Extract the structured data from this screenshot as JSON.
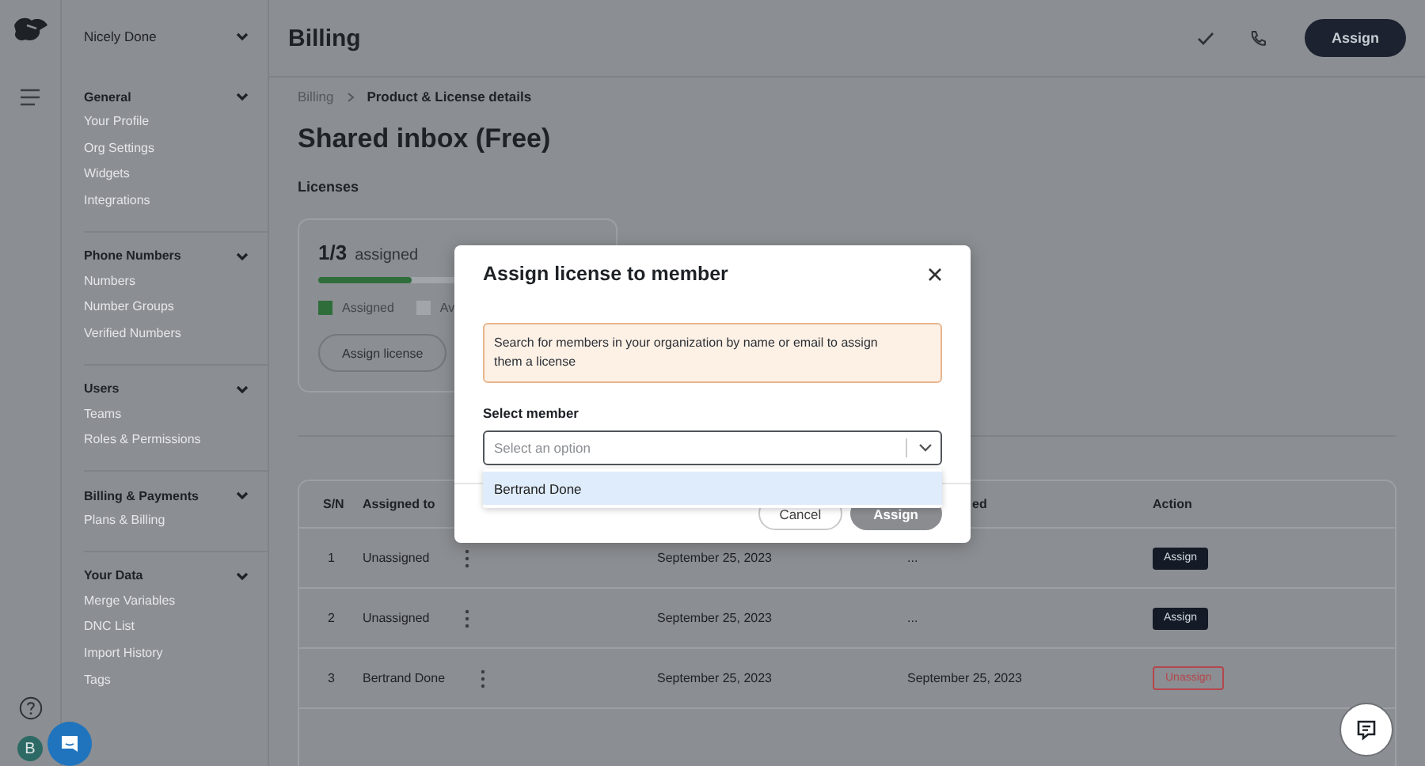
{
  "account": {
    "name": "Nicely Done",
    "avatar_initial": "B"
  },
  "sidebar": {
    "sections": [
      {
        "title": "General",
        "expanded": true,
        "items": [
          "Your Profile",
          "Org Settings",
          "Widgets",
          "Integrations"
        ]
      },
      {
        "title": "Phone Numbers",
        "expanded": true,
        "items": [
          "Numbers",
          "Number Groups",
          "Verified Numbers"
        ]
      },
      {
        "title": "Users",
        "expanded": true,
        "items": [
          "Teams",
          "Roles & Permissions"
        ]
      },
      {
        "title": "Billing & Payments",
        "expanded": true,
        "items": [
          "Plans & Billing"
        ]
      },
      {
        "title": "Your Data",
        "expanded": true,
        "items": [
          "Merge Variables",
          "DNC List",
          "Import History",
          "Tags"
        ]
      }
    ]
  },
  "header": {
    "title": "Billing",
    "button": "Assign"
  },
  "breadcrumb": [
    "Billing",
    "Product & License details"
  ],
  "page_title": "Shared inbox (Free)",
  "licenses": {
    "heading": "Licenses",
    "count": "1/3",
    "count_label": "assigned",
    "level": 0.333,
    "legend": [
      {
        "label": "Assigned",
        "color": "#2f6e3b"
      },
      {
        "label": "Av",
        "color": "#a2a5a9"
      }
    ],
    "button": "Assign license"
  },
  "table": {
    "columns": {
      "sn": "S/N",
      "assigned_to": "Assigned to",
      "column_4": "ed",
      "action": "Action"
    },
    "rows": [
      {
        "sn": "1",
        "assigned_to": "Unassigned",
        "column_3": "September 25, 2023",
        "column_4": "...",
        "action": {
          "kind": "assign",
          "label": "Assign"
        }
      },
      {
        "sn": "2",
        "assigned_to": "Unassigned",
        "column_3": "September 25, 2023",
        "column_4": "...",
        "action": {
          "kind": "assign",
          "label": "Assign"
        }
      },
      {
        "sn": "3",
        "assigned_to": "Bertrand Done",
        "column_3": "September 25, 2023",
        "column_4": "September 25, 2023",
        "action": {
          "kind": "unassign",
          "label": "Unassign"
        }
      }
    ]
  },
  "modal": {
    "title": "Assign license to member",
    "info": "Search for members in your organization by name or email to assign them a license",
    "field_label": "Select member",
    "select": {
      "placeholder": "Select an option"
    },
    "options": [
      {
        "label": "Bertrand Done",
        "selected": true
      }
    ],
    "buttons": [
      {
        "label": "Cancel",
        "kind": "secondary",
        "disabled": false
      },
      {
        "label": "Assign",
        "kind": "primary",
        "disabled": true
      }
    ]
  }
}
